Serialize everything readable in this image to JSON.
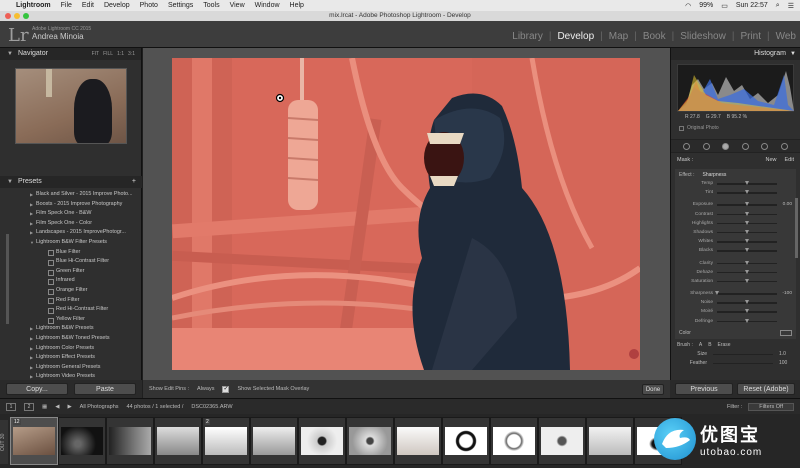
{
  "menubar": {
    "app": "Lightroom",
    "items": [
      "File",
      "Edit",
      "Develop",
      "Photo",
      "Settings",
      "Tools",
      "View",
      "Window",
      "Help"
    ],
    "battery": "99%",
    "clock": "Sun 22:57"
  },
  "window": {
    "title": "mix.lrcat - Adobe Photoshop Lightroom - Develop"
  },
  "header": {
    "logo": "Lr",
    "version": "Adobe Lightroom CC 2015",
    "user": "Andrea Minoia",
    "modules": [
      "Library",
      "Develop",
      "Map",
      "Book",
      "Slideshow",
      "Print",
      "Web"
    ],
    "active_module": "Develop"
  },
  "navigator": {
    "title": "Navigator",
    "modes": [
      "FIT",
      "FILL",
      "1:1",
      "3:1"
    ]
  },
  "presets": {
    "title": "Presets",
    "items": [
      {
        "label": "Black and Silver - 2015 Improve Photo...",
        "type": "folder"
      },
      {
        "label": "Boosts - 2015 Improve Photography",
        "type": "folder"
      },
      {
        "label": "Film Speck One - B&W",
        "type": "folder"
      },
      {
        "label": "Film Speck One - Color",
        "type": "folder"
      },
      {
        "label": "Landscapes - 2015 ImprovePhotogr...",
        "type": "folder"
      },
      {
        "label": "Lightroom B&W Filter Presets",
        "type": "open"
      },
      {
        "label": "Blue Filter",
        "type": "child"
      },
      {
        "label": "Blue Hi-Contrast Filter",
        "type": "child"
      },
      {
        "label": "Green Filter",
        "type": "child"
      },
      {
        "label": "Infrared",
        "type": "child"
      },
      {
        "label": "Orange Filter",
        "type": "child"
      },
      {
        "label": "Red Filter",
        "type": "child"
      },
      {
        "label": "Red Hi-Contrast Filter",
        "type": "child"
      },
      {
        "label": "Yellow Filter",
        "type": "child"
      },
      {
        "label": "Lightroom B&W Presets",
        "type": "folder"
      },
      {
        "label": "Lightroom B&W Toned Presets",
        "type": "folder"
      },
      {
        "label": "Lightroom Color Presets",
        "type": "folder"
      },
      {
        "label": "Lightroom Effect Presets",
        "type": "folder"
      },
      {
        "label": "Lightroom General Presets",
        "type": "folder"
      },
      {
        "label": "Lightroom Video Presets",
        "type": "folder"
      }
    ]
  },
  "left_buttons": {
    "copy": "Copy...",
    "paste": "Paste"
  },
  "toolbar": {
    "show_edit_pins_label": "Show Edit Pins :",
    "show_edit_pins_value": "Always",
    "mask_overlay_label": "Show Selected Mask Overlay",
    "done": "Done"
  },
  "histogram": {
    "title": "Histogram",
    "r_label": "R",
    "r_value": "27.8",
    "g_label": "G",
    "g_value": "29.7",
    "b_label": "B",
    "b_value": "95.2",
    "pct": "%",
    "original_photo": "Original Photo"
  },
  "mask": {
    "label": "Mask :",
    "new": "New",
    "edit": "Edit",
    "effect_label": "Effect :",
    "effect_value": "Sharpness"
  },
  "adjustments": [
    {
      "label": "Temp",
      "value": "",
      "pos": 0.5
    },
    {
      "label": "Tint",
      "value": "",
      "pos": 0.5
    },
    {
      "label": "Exposure",
      "value": "0.00",
      "pos": 0.5
    },
    {
      "label": "Contrast",
      "value": "",
      "pos": 0.5
    },
    {
      "label": "Highlights",
      "value": "",
      "pos": 0.5
    },
    {
      "label": "Shadows",
      "value": "",
      "pos": 0.5
    },
    {
      "label": "Whites",
      "value": "",
      "pos": 0.5
    },
    {
      "label": "Blacks",
      "value": "",
      "pos": 0.5
    },
    {
      "label": "Clarity",
      "value": "",
      "pos": 0.5
    },
    {
      "label": "Dehaze",
      "value": "",
      "pos": 0.5
    },
    {
      "label": "Saturation",
      "value": "",
      "pos": 0.5
    },
    {
      "label": "Sharpness",
      "value": "-100",
      "pos": 0.0
    },
    {
      "label": "Noise",
      "value": "",
      "pos": 0.5
    },
    {
      "label": "Moiré",
      "value": "",
      "pos": 0.5
    },
    {
      "label": "Defringe",
      "value": "",
      "pos": 0.5
    }
  ],
  "color_label": "Color",
  "brush": {
    "label": "Brush :",
    "a": "A",
    "b": "B",
    "erase": "Erase",
    "size_label": "Size",
    "size_value": "1.0",
    "feather_label": "Feather",
    "feather_value": "100"
  },
  "right_buttons": {
    "previous": "Previous",
    "reset": "Reset (Adobe)"
  },
  "filmstrip_bar": {
    "page1": "1",
    "page2": "2",
    "source": "All Photographs",
    "count": "44 photos / 1 selected /",
    "filename": "DSC02365.ARW",
    "filter_label": "Filter :",
    "filter_value": "Filters Off"
  },
  "filmstrip": [
    {
      "idx": "12",
      "sel": true
    },
    {
      "idx": "",
      "sel": false
    },
    {
      "idx": "",
      "sel": false
    },
    {
      "idx": "",
      "sel": false
    },
    {
      "idx": "2",
      "sel": false
    },
    {
      "idx": "",
      "sel": false
    },
    {
      "idx": "",
      "sel": false
    },
    {
      "idx": "",
      "sel": false
    },
    {
      "idx": "",
      "sel": false
    },
    {
      "idx": "",
      "sel": false
    },
    {
      "idx": "",
      "sel": false
    },
    {
      "idx": "",
      "sel": false
    },
    {
      "idx": "",
      "sel": false
    },
    {
      "idx": "",
      "sel": false
    }
  ],
  "side_tab": "OUT 30",
  "watermark": {
    "cn": "优图宝",
    "en": "utobao.com"
  },
  "colors": {
    "mask_overlay": "#d96b5c",
    "panel": "#2f2f2f",
    "active_text": "#eeeeee"
  }
}
